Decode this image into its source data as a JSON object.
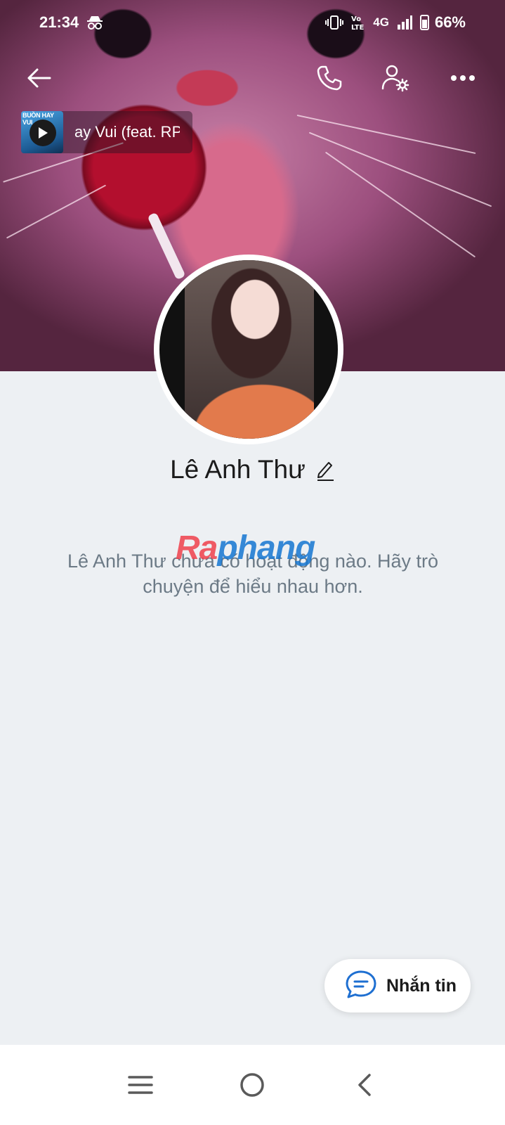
{
  "status_bar": {
    "time": "21:34",
    "network": "4G",
    "battery": "66%",
    "icons": [
      "incognito-icon",
      "vibrate-icon",
      "volte-icon",
      "signal-icon",
      "battery-icon"
    ]
  },
  "top_bar": {
    "icons": [
      "back-arrow-icon",
      "phone-icon",
      "user-settings-icon",
      "more-icon"
    ]
  },
  "music": {
    "thumb_text": "BUỒN HAY VUI",
    "title": "ay Vui (feat. RP"
  },
  "profile": {
    "name": "Lê Anh Thư"
  },
  "empty_state": {
    "message": "Lê Anh Thư chưa có hoạt động nào. Hãy trò chuyện để hiểu nhau hơn."
  },
  "watermark": {
    "part1": "Ra",
    "part2": "phang"
  },
  "actions": {
    "message_label": "Nhắn tin"
  },
  "nav_bar": {
    "icons": [
      "recent-apps-icon",
      "home-icon",
      "back-icon"
    ]
  },
  "colors": {
    "background": "#edf0f3",
    "accent": "#1e6fd1",
    "secondary_text": "#6c7a86"
  }
}
